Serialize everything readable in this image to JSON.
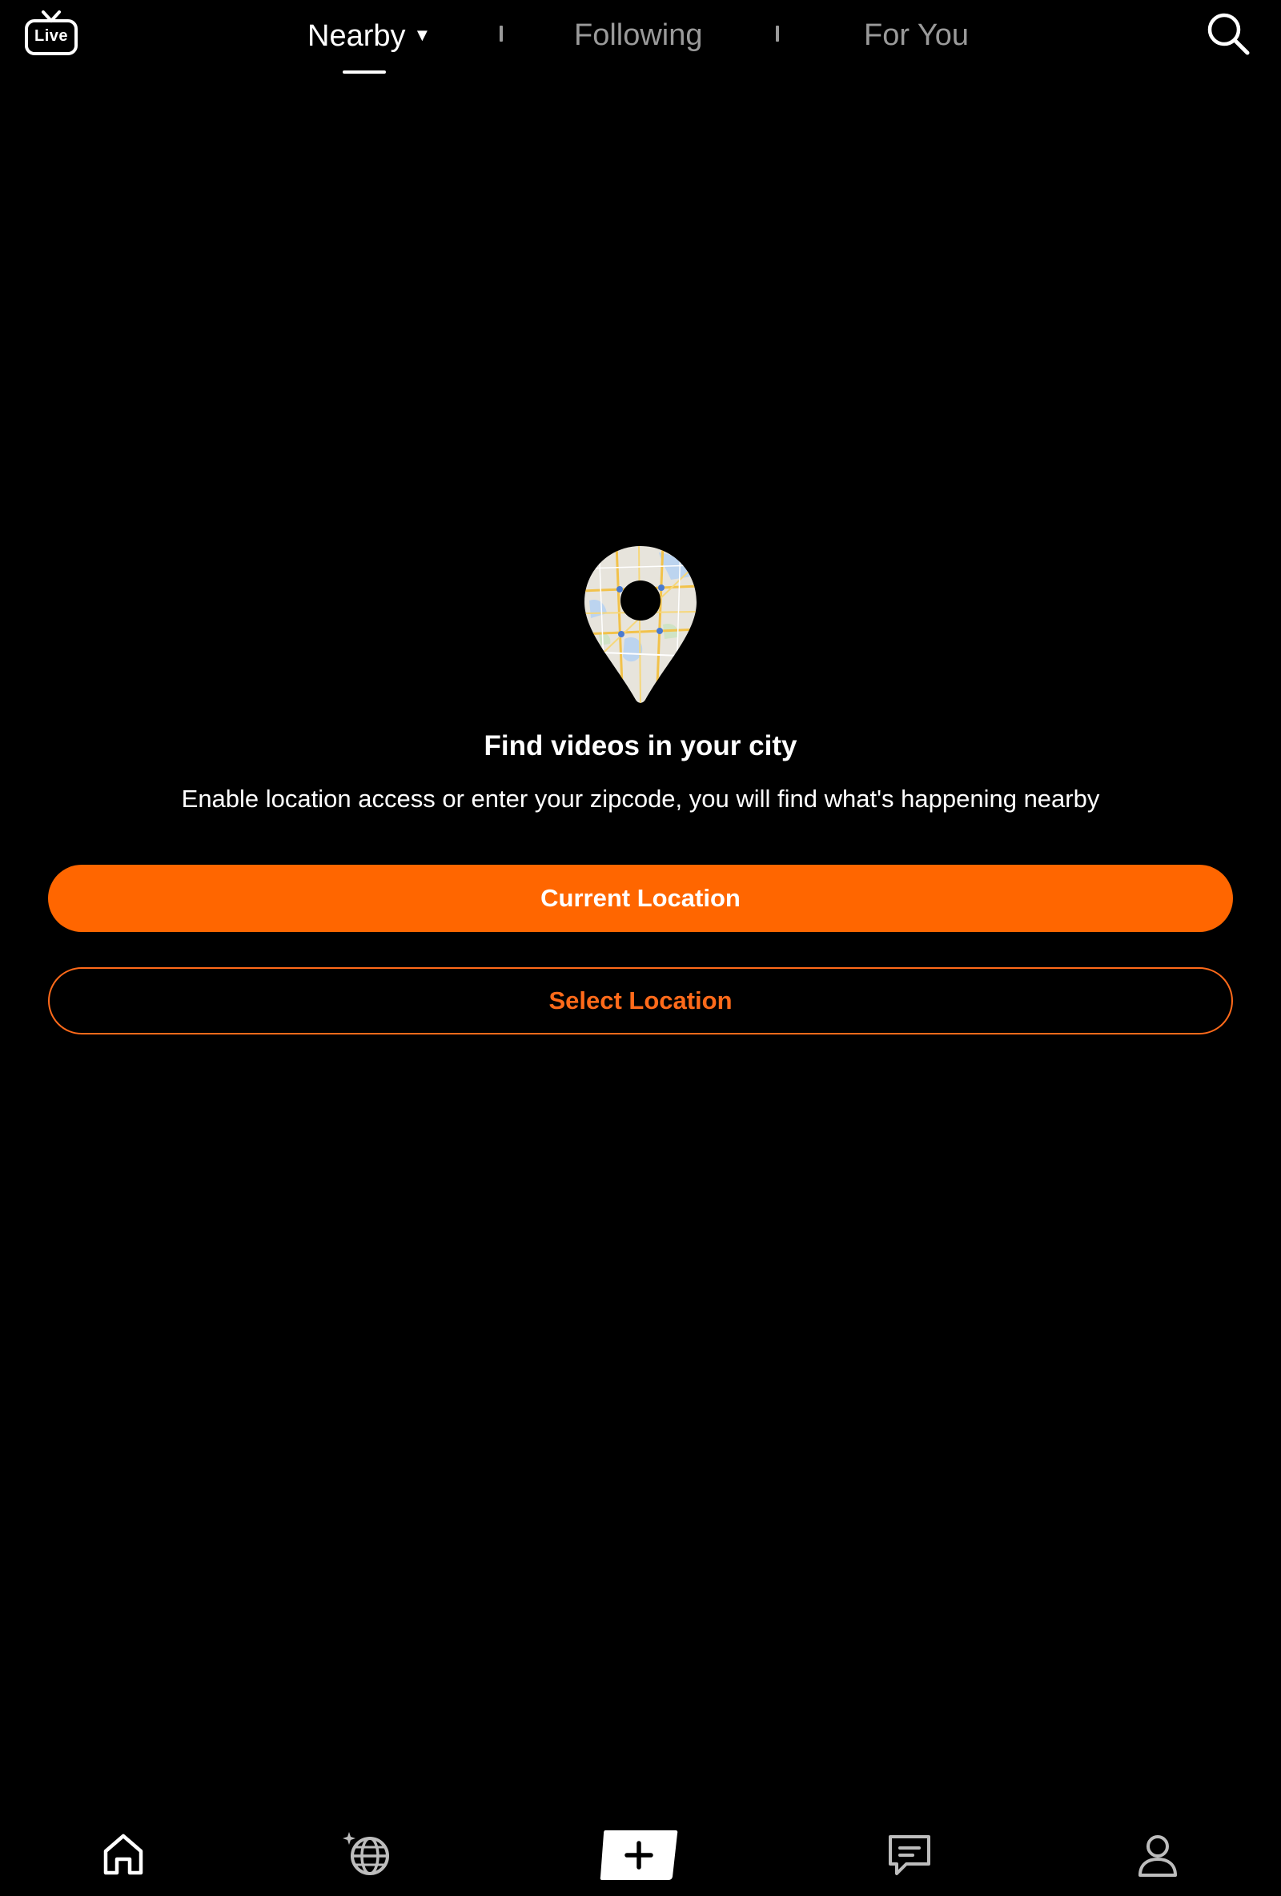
{
  "header": {
    "live_label": "Live",
    "tabs": [
      {
        "label": "Nearby",
        "active": true,
        "has_dropdown": true
      },
      {
        "label": "Following",
        "active": false
      },
      {
        "label": "For You",
        "active": false
      }
    ],
    "caret_glyph": "▼",
    "search_icon": "search-icon"
  },
  "empty_state": {
    "icon": "map-pin-icon",
    "title": "Find videos in your city",
    "description": "Enable location access or enter your zipcode, you will find what's happening nearby",
    "primary_button": "Current Location",
    "secondary_button": "Select Location"
  },
  "bottom_nav": {
    "items": [
      {
        "icon": "home-icon"
      },
      {
        "icon": "globe-sparkle-icon"
      },
      {
        "icon": "plus-icon"
      },
      {
        "icon": "chat-bubble-icon"
      },
      {
        "icon": "person-icon"
      }
    ]
  },
  "colors": {
    "background": "#000000",
    "accent": "#FF6600",
    "text_primary": "#FFFFFF",
    "text_inactive": "#9A9A9A"
  }
}
